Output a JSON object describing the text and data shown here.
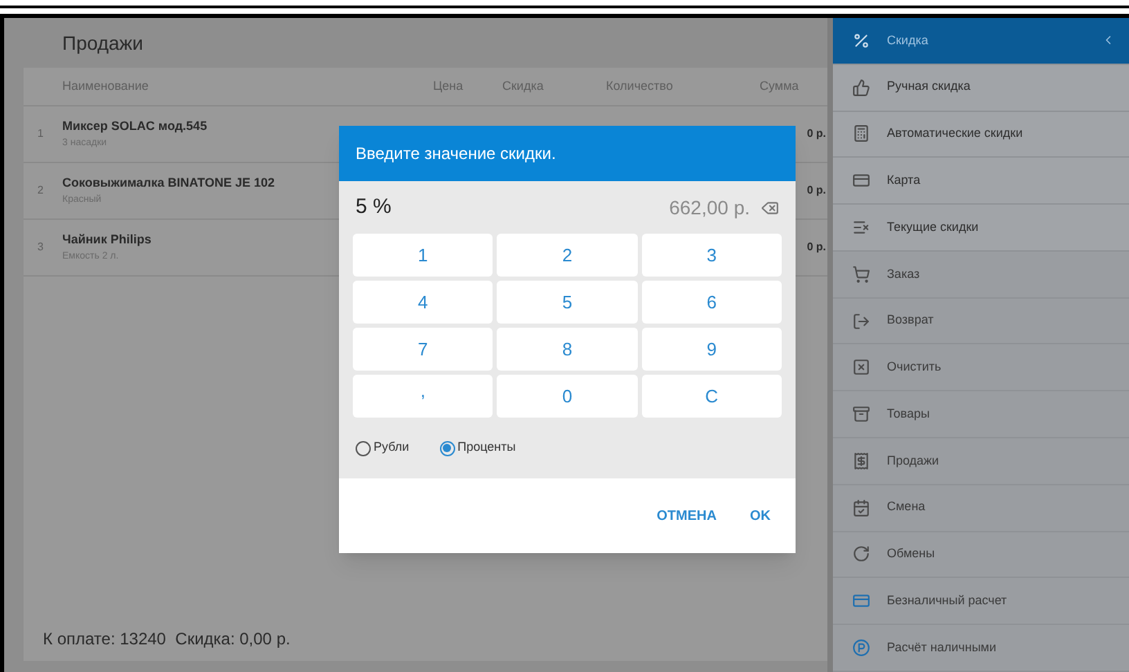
{
  "main": {
    "title": "Продажи",
    "table": {
      "columns": [
        "Наименование",
        "Цена",
        "Скидка",
        "Количество",
        "Сумма"
      ],
      "rows": [
        {
          "index": "1",
          "name": "Миксер SOLAC мод.545",
          "note": "3 насадки",
          "sum": "0 р."
        },
        {
          "index": "2",
          "name": "Соковыжималка  BINATONE JE 102",
          "note": "Красный",
          "sum": "0 р."
        },
        {
          "index": "3",
          "name": "Чайник Philips",
          "note": "Емкость 2 л.",
          "sum": "0 р."
        }
      ]
    },
    "footer": "К оплате: 13240  Скидка: 0,00 р."
  },
  "dialog": {
    "title": "Введите значение скидки.",
    "value": "5 %",
    "amount": "662,00 р.",
    "keys": [
      "1",
      "2",
      "3",
      "4",
      "5",
      "6",
      "7",
      "8",
      "9",
      ",",
      "0",
      "C"
    ],
    "units": [
      {
        "label": "Рубли",
        "selected": false
      },
      {
        "label": "Проценты",
        "selected": true
      }
    ],
    "buttons": [
      "ОТМЕНА",
      "OK"
    ]
  },
  "sidebar": {
    "items": [
      {
        "label": "Скидка",
        "expanded": true,
        "selected": true,
        "children": [
          {
            "label": "Ручная скидка"
          },
          {
            "label": "Автоматические скидки"
          },
          {
            "label": "Карта"
          },
          {
            "label": "Текущие скидки"
          }
        ]
      },
      {
        "label": "Заказ"
      },
      {
        "label": "Возврат"
      },
      {
        "label": "Очистить"
      },
      {
        "label": "Товары"
      },
      {
        "label": "Продажи"
      },
      {
        "label": "Смена"
      },
      {
        "label": "Обмены"
      },
      {
        "label": "Безналичный расчет"
      },
      {
        "label": "Расчёт наличными"
      }
    ]
  }
}
